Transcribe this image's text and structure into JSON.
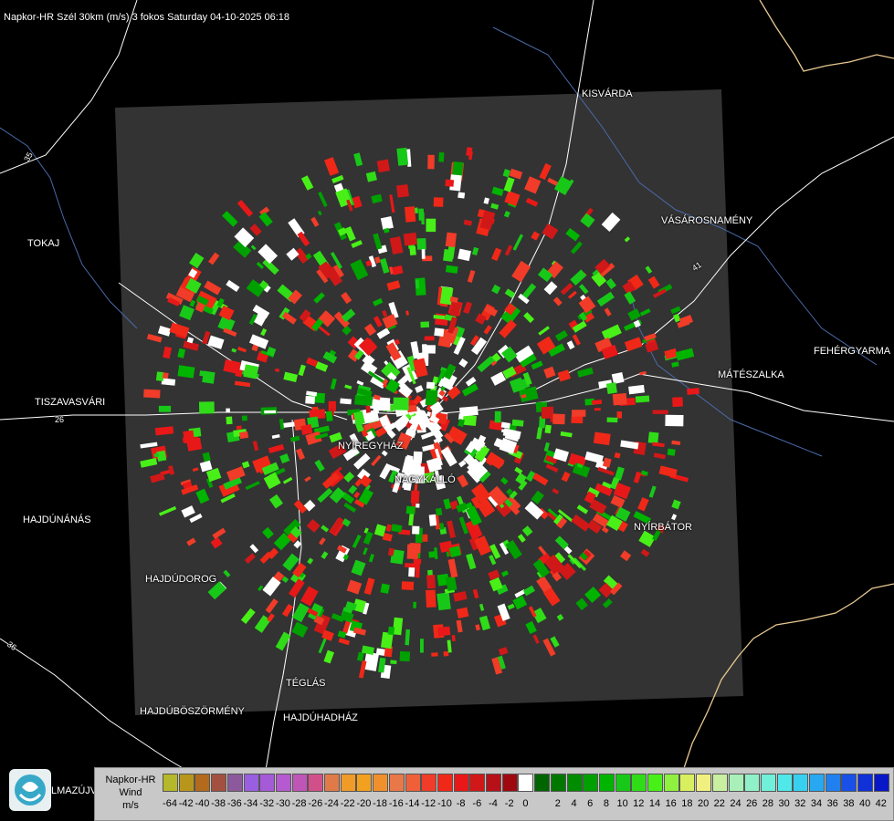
{
  "title": "Napkor-HR Szél 30km (m/s) 3 fokos Saturday 04-10-2025 06:18",
  "cities": {
    "kisvarda": "KISVÁRDA",
    "tokaj": "TOKAJ",
    "vasarosnameny": "VÁSÁROSNAMÉNY",
    "fehergyarmat": "FEHÉRGYARMA",
    "mateszalka": "MÁTÉSZALKA",
    "tiszavasvari": "TISZAVASVÁRI",
    "nyiregyhaza": "NYÍREGYHÁZ",
    "nagykallo": "NAGYKÁLLÓ",
    "hajdunanas": "HAJDÚNÁNÁS",
    "nyirbator": "NYÍRBÁTOR",
    "hajdudorog": "HAJDÚDOROG",
    "teglas": "TÉGLÁS",
    "hajduboszormeny": "HAJDÚBÖSZÖRMÉNY",
    "hajduhadhaz": "HAJDÚHADHÁZ",
    "hajdunanas_partial": "LMAZÚJVÁR"
  },
  "roads": {
    "r35": "35",
    "r26": "26",
    "r41": "41",
    "r36": "36"
  },
  "legend": {
    "line1": "Napkor-HR",
    "line2": "Wind",
    "line3": "m/s",
    "scale": [
      {
        "v": "-64",
        "c": "#b5b82a"
      },
      {
        "v": "-42",
        "c": "#b8961c"
      },
      {
        "v": "-40",
        "c": "#b36a1c"
      },
      {
        "v": "-38",
        "c": "#a35040"
      },
      {
        "v": "-36",
        "c": "#8c5a9c"
      },
      {
        "v": "-34",
        "c": "#9a5ee0"
      },
      {
        "v": "-32",
        "c": "#a55ad8"
      },
      {
        "v": "-30",
        "c": "#b55ad0"
      },
      {
        "v": "-28",
        "c": "#c055b8"
      },
      {
        "v": "-26",
        "c": "#d2508a"
      },
      {
        "v": "-24",
        "c": "#e07a48"
      },
      {
        "v": "-22",
        "c": "#f09a28"
      },
      {
        "v": "-20",
        "c": "#f2a020"
      },
      {
        "v": "-18",
        "c": "#f0902c"
      },
      {
        "v": "-16",
        "c": "#e87848"
      },
      {
        "v": "-14",
        "c": "#f06038"
      },
      {
        "v": "-12",
        "c": "#f03c28"
      },
      {
        "v": "-10",
        "c": "#f02818"
      },
      {
        "v": "-8",
        "c": "#e81818"
      },
      {
        "v": "-6",
        "c": "#d01818"
      },
      {
        "v": "-4",
        "c": "#b81018"
      },
      {
        "v": "-2",
        "c": "#a00810"
      },
      {
        "v": "0",
        "c": "#ffffff"
      },
      {
        "v": "",
        "c": "#006400"
      },
      {
        "v": "2",
        "c": "#007800"
      },
      {
        "v": "4",
        "c": "#008c00"
      },
      {
        "v": "6",
        "c": "#00a000"
      },
      {
        "v": "8",
        "c": "#00b400"
      },
      {
        "v": "10",
        "c": "#18c818"
      },
      {
        "v": "12",
        "c": "#30dc18"
      },
      {
        "v": "14",
        "c": "#48f018"
      },
      {
        "v": "16",
        "c": "#90f040"
      },
      {
        "v": "18",
        "c": "#d8f060"
      },
      {
        "v": "20",
        "c": "#f0f080"
      },
      {
        "v": "22",
        "c": "#c8f0a0"
      },
      {
        "v": "24",
        "c": "#a8f0b8"
      },
      {
        "v": "26",
        "c": "#90f0c8"
      },
      {
        "v": "28",
        "c": "#70f0d8"
      },
      {
        "v": "30",
        "c": "#50e8e8"
      },
      {
        "v": "32",
        "c": "#38d0f0"
      },
      {
        "v": "34",
        "c": "#28a8f0"
      },
      {
        "v": "36",
        "c": "#2080f0"
      },
      {
        "v": "38",
        "c": "#1850e8"
      },
      {
        "v": "40",
        "c": "#1030d8"
      },
      {
        "v": "42",
        "c": "#0818c8"
      }
    ]
  },
  "colors": {
    "background": "#000000",
    "radar_domain": "#333333",
    "roads": "#ffffff",
    "rivers": "#5a7ab8",
    "border": "#e8c890"
  }
}
